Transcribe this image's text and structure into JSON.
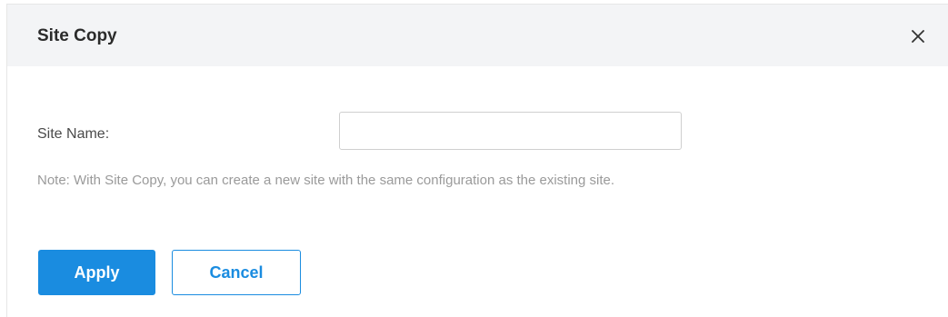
{
  "dialog": {
    "title": "Site Copy",
    "close_icon": "close-icon"
  },
  "form": {
    "site_name_label": "Site Name:",
    "site_name_value": "",
    "site_name_placeholder": "",
    "note": "Note: With Site Copy, you can create a new site with the same configuration as the existing site."
  },
  "buttons": {
    "apply_label": "Apply",
    "cancel_label": "Cancel"
  },
  "colors": {
    "accent": "#1a8ce0",
    "header_bg": "#f3f4f6",
    "note_text": "#9a9a9a"
  }
}
